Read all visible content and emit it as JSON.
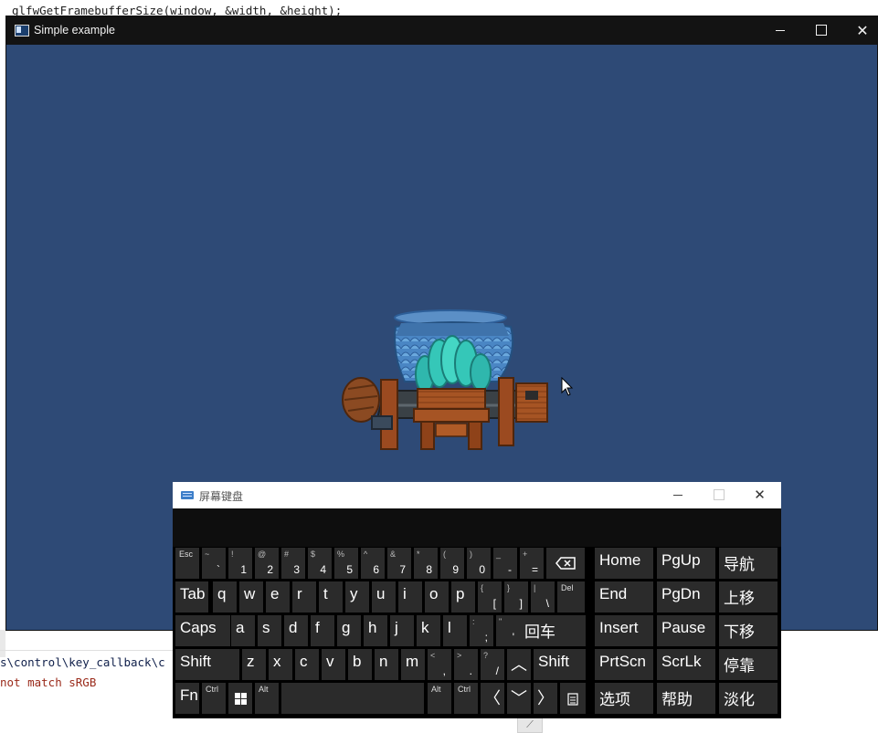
{
  "editor": {
    "top_line": "glfwGetFramebufferSize(window, &width, &height);",
    "path_line": "s\\control\\key_callback\\c",
    "warn_line": "not match sRGB"
  },
  "window": {
    "title": "Simple example",
    "background": "#2e4a76",
    "controls": {
      "minimize": "minimize-icon",
      "maximize": "maximize-icon",
      "close": "close-icon"
    }
  },
  "osk": {
    "title": "屏幕键盘",
    "rows": [
      [
        {
          "id": "esc",
          "small": "Esc"
        },
        {
          "id": "tilde",
          "hi": "~",
          "lo": "`"
        },
        {
          "id": "k1",
          "hi": "!",
          "lo": "1"
        },
        {
          "id": "k2",
          "hi": "@",
          "lo": "2"
        },
        {
          "id": "k3",
          "hi": "#",
          "lo": "3"
        },
        {
          "id": "k4",
          "hi": "$",
          "lo": "4"
        },
        {
          "id": "k5",
          "hi": "%",
          "lo": "5"
        },
        {
          "id": "k6",
          "hi": "^",
          "lo": "6"
        },
        {
          "id": "k7",
          "hi": "&",
          "lo": "7"
        },
        {
          "id": "k8",
          "hi": "*",
          "lo": "8"
        },
        {
          "id": "k9",
          "hi": "(",
          "lo": "9"
        },
        {
          "id": "k0",
          "hi": ")",
          "lo": "0"
        },
        {
          "id": "minus",
          "hi": "_",
          "lo": "-"
        },
        {
          "id": "equals",
          "hi": "+",
          "lo": "="
        },
        {
          "id": "backspace",
          "icon": "backspace-icon"
        },
        {
          "id": "home",
          "label": "Home"
        },
        {
          "id": "pgup",
          "label": "PgUp"
        },
        {
          "id": "nav",
          "label": "导航"
        }
      ],
      [
        {
          "id": "tab",
          "label": "Tab"
        },
        {
          "id": "q",
          "label": "q"
        },
        {
          "id": "w",
          "label": "w"
        },
        {
          "id": "e",
          "label": "e"
        },
        {
          "id": "r",
          "label": "r"
        },
        {
          "id": "t",
          "label": "t"
        },
        {
          "id": "y",
          "label": "y"
        },
        {
          "id": "u",
          "label": "u"
        },
        {
          "id": "i",
          "label": "i"
        },
        {
          "id": "o",
          "label": "o"
        },
        {
          "id": "p",
          "label": "p"
        },
        {
          "id": "lbracket",
          "hi": "{",
          "lo": "["
        },
        {
          "id": "rbracket",
          "hi": "}",
          "lo": "]"
        },
        {
          "id": "backslash",
          "hi": "|",
          "lo": "\\"
        },
        {
          "id": "del",
          "small": "Del"
        },
        {
          "id": "end",
          "label": "End"
        },
        {
          "id": "pgdn",
          "label": "PgDn"
        },
        {
          "id": "moveup",
          "label": "上移"
        }
      ],
      [
        {
          "id": "caps",
          "label": "Caps"
        },
        {
          "id": "a",
          "label": "a"
        },
        {
          "id": "s",
          "label": "s"
        },
        {
          "id": "d",
          "label": "d"
        },
        {
          "id": "f",
          "label": "f"
        },
        {
          "id": "g",
          "label": "g"
        },
        {
          "id": "h",
          "label": "h"
        },
        {
          "id": "j",
          "label": "j"
        },
        {
          "id": "k",
          "label": "k"
        },
        {
          "id": "l",
          "label": "l"
        },
        {
          "id": "semicolon",
          "hi": ":",
          "lo": ";"
        },
        {
          "id": "quote",
          "hi": "\"",
          "lo": "'"
        },
        {
          "id": "enter",
          "label": "回车"
        },
        {
          "id": "insert",
          "label": "Insert"
        },
        {
          "id": "pause",
          "label": "Pause"
        },
        {
          "id": "movedown",
          "label": "下移"
        }
      ],
      [
        {
          "id": "lshift",
          "label": "Shift"
        },
        {
          "id": "z",
          "label": "z"
        },
        {
          "id": "x",
          "label": "x"
        },
        {
          "id": "c",
          "label": "c"
        },
        {
          "id": "v",
          "label": "v"
        },
        {
          "id": "b",
          "label": "b"
        },
        {
          "id": "n",
          "label": "n"
        },
        {
          "id": "m",
          "label": "m"
        },
        {
          "id": "comma",
          "hi": "<",
          "lo": ","
        },
        {
          "id": "period",
          "hi": ">",
          "lo": "."
        },
        {
          "id": "slash",
          "hi": "?",
          "lo": "/"
        },
        {
          "id": "up",
          "sym": "︿"
        },
        {
          "id": "rshift",
          "label": "Shift"
        },
        {
          "id": "prtscn",
          "label": "PrtScn"
        },
        {
          "id": "scrlk",
          "label": "ScrLk"
        },
        {
          "id": "dock",
          "label": "停靠"
        }
      ],
      [
        {
          "id": "fn",
          "label": "Fn"
        },
        {
          "id": "lctrl",
          "small": "Ctrl"
        },
        {
          "id": "win",
          "icon": "windows-icon"
        },
        {
          "id": "lalt",
          "small": "Alt"
        },
        {
          "id": "space",
          "label": ""
        },
        {
          "id": "ralt",
          "small": "Alt"
        },
        {
          "id": "rctrl",
          "small": "Ctrl"
        },
        {
          "id": "left",
          "sym": "〈"
        },
        {
          "id": "down",
          "sym": "﹀"
        },
        {
          "id": "right",
          "sym": "〉"
        },
        {
          "id": "menu",
          "icon": "context-menu-icon"
        },
        {
          "id": "options",
          "label": "选项"
        },
        {
          "id": "help",
          "label": "帮助"
        },
        {
          "id": "fade",
          "label": "淡化"
        }
      ]
    ]
  }
}
